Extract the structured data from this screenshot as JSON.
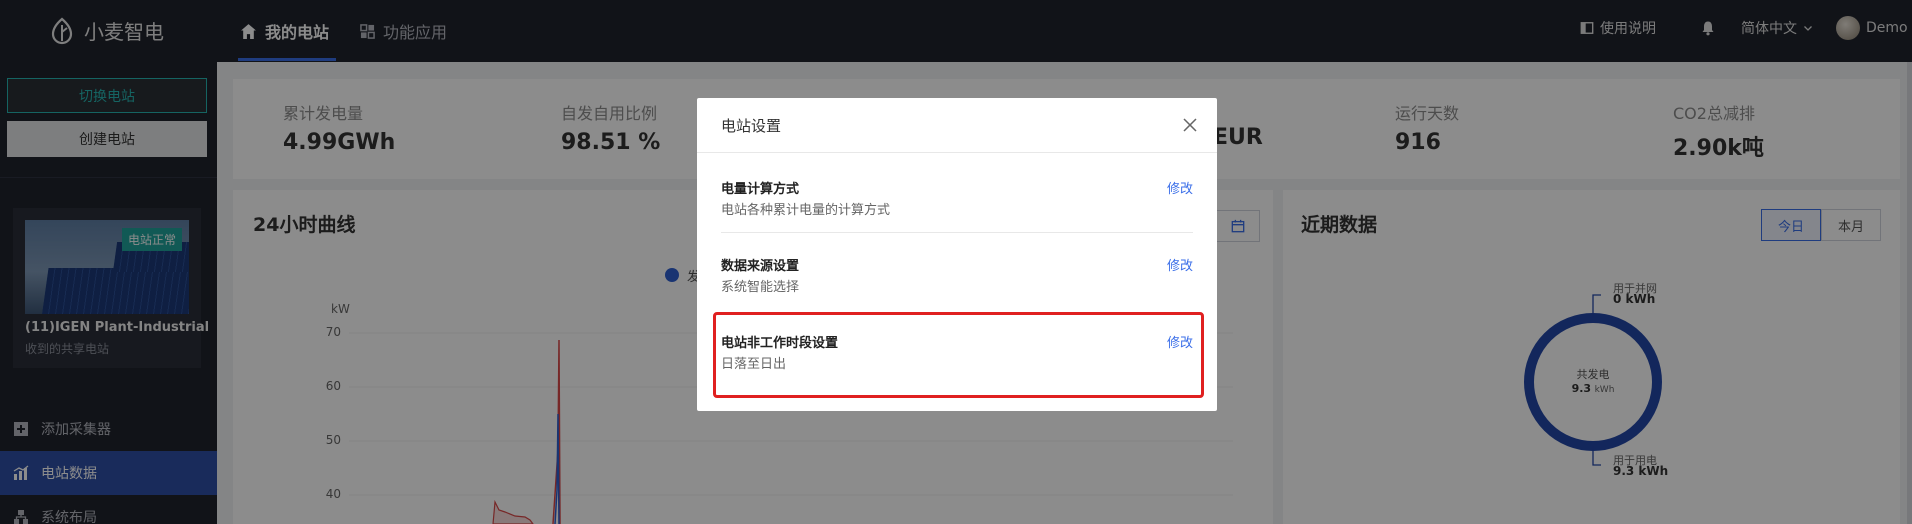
{
  "app": {
    "name": "小麦智电"
  },
  "nav": {
    "tabs": [
      {
        "label": "我的电站",
        "icon": "home-icon"
      },
      {
        "label": "功能应用",
        "icon": "apps-icon"
      }
    ],
    "manual_label": "使用说明",
    "language_label": "简体中文",
    "user_label": "Demo"
  },
  "sidebar": {
    "switch_button": "切换电站",
    "create_button": "创建电站",
    "plant": {
      "status": "电站正常",
      "name": "(11)IGEN Plant-Industrial",
      "subtitle": "收到的共享电站"
    },
    "menu": [
      {
        "label": "添加采集器",
        "icon": "plus-square-icon"
      },
      {
        "label": "电站数据",
        "icon": "chart-icon"
      },
      {
        "label": "系统布局",
        "icon": "layout-icon"
      }
    ]
  },
  "stats": [
    {
      "label": "累计发电量",
      "value": "4.99GWh"
    },
    {
      "label": "自发自用比例",
      "value": "98.51 %"
    },
    {
      "label": "",
      "value": "EUR"
    },
    {
      "label": "运行天数",
      "value": "916"
    },
    {
      "label": "CO2总减排",
      "value": "2.90k吨"
    }
  ],
  "curve": {
    "title": "24小时曲线",
    "unit": "kW",
    "legend_fragment": "发",
    "y_ticks": [
      "70",
      "60",
      "50",
      "40"
    ]
  },
  "recent": {
    "title": "近期数据",
    "tabs": [
      "今日",
      "本月"
    ],
    "donut": {
      "center_label": "共发电",
      "center_value": "9.3",
      "center_unit": "kWh",
      "grid_label": "用于并网",
      "grid_value": "0 kWh",
      "use_label": "用于用电",
      "use_value": "9.3 kWh"
    }
  },
  "modal": {
    "title": "电站设置",
    "settings": [
      {
        "title": "电量计算方式",
        "desc": "电站各种累计电量的计算方式",
        "action": "修改"
      },
      {
        "title": "数据来源设置",
        "desc": "系统智能选择",
        "action": "修改"
      },
      {
        "title": "电站非工作时段设置",
        "desc": "日落至日出",
        "action": "修改"
      }
    ]
  },
  "colors": {
    "accent": "#3a6ee8",
    "topbar": "#20232d",
    "teal": "#27b6b2",
    "highlight": "#e02020"
  }
}
